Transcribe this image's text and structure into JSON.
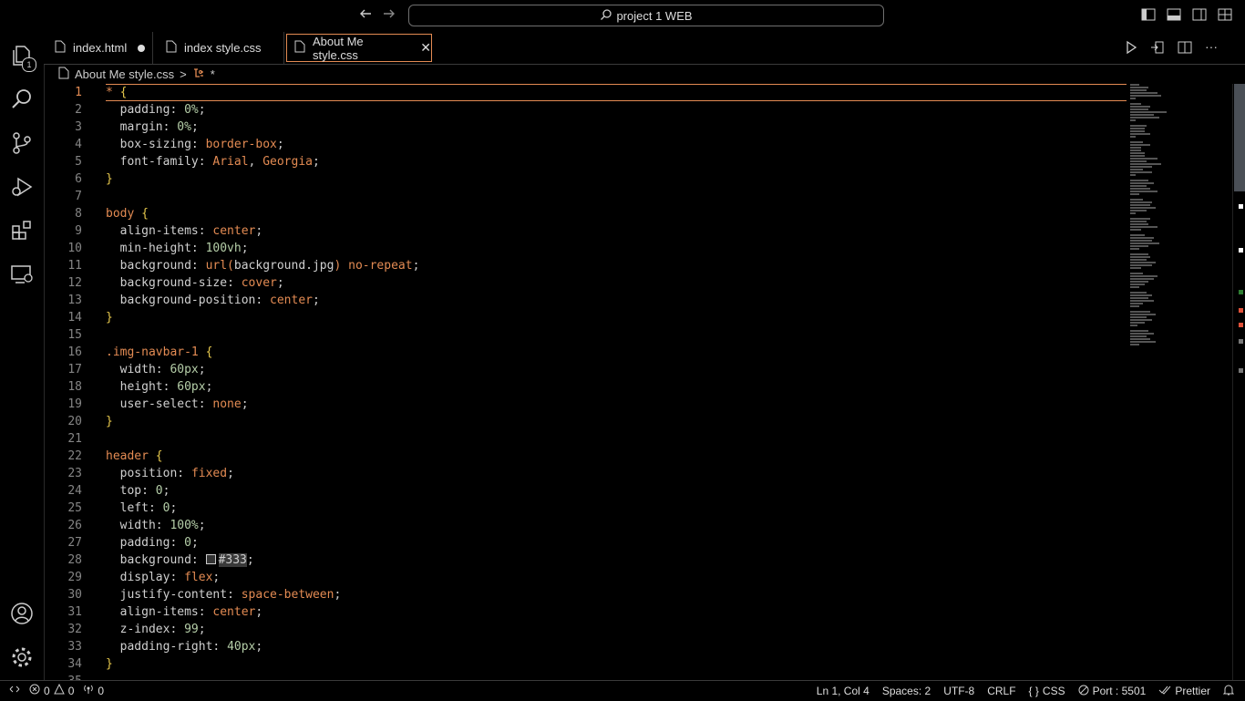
{
  "titlebar": {
    "search_text": "project 1 WEB"
  },
  "activity_bar": {
    "explorer_badge": "1"
  },
  "tabs": [
    {
      "label": "index.html",
      "modified": true
    },
    {
      "label": "index style.css",
      "modified": false
    },
    {
      "label": "About Me style.css",
      "active": true,
      "close": "✕"
    }
  ],
  "breadcrumb": {
    "file": "About Me style.css",
    "sep": ">",
    "symbol": "*"
  },
  "editor": {
    "line_numbers": [
      "1",
      "2",
      "3",
      "4",
      "5",
      "6",
      "7",
      "8",
      "9",
      "10",
      "11",
      "12",
      "13",
      "14",
      "15",
      "16",
      "17",
      "18",
      "19",
      "20",
      "21",
      "22",
      "23",
      "24",
      "25",
      "26",
      "27",
      "28",
      "29",
      "30",
      "31",
      "32",
      "33",
      "34",
      "35"
    ],
    "current_line": "1"
  },
  "statusbar": {
    "errors": "0",
    "warnings": "0",
    "ports": "0",
    "position": "Ln 1, Col 4",
    "spaces": "Spaces: 2",
    "encoding": "UTF-8",
    "eol": "CRLF",
    "language": "CSS",
    "language_icon": "{ }",
    "port": "Port : 5501",
    "prettier": "Prettier"
  },
  "colors": {
    "accent": "#e38b53",
    "background": "#000000"
  }
}
